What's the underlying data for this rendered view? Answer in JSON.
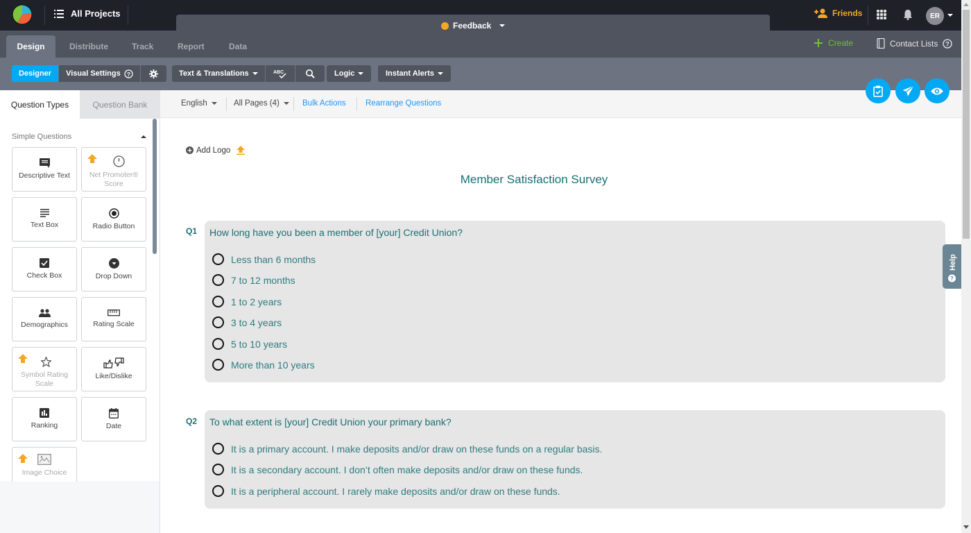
{
  "topbar": {
    "projects_label": "All Projects",
    "survey_name": "Feedback",
    "survey_status_color": "#f5a623",
    "friends_label": "Friends",
    "avatar_initials": "ER"
  },
  "nav": {
    "tabs": [
      {
        "label": "Design",
        "active": true
      },
      {
        "label": "Distribute"
      },
      {
        "label": "Track"
      },
      {
        "label": "Report"
      },
      {
        "label": "Data"
      }
    ],
    "create_label": "Create",
    "contact_lists_label": "Contact Lists"
  },
  "toolbar": {
    "designer_label": "Designer",
    "visual_settings_label": "Visual Settings",
    "text_translations_label": "Text & Translations",
    "spellcheck_label": "ABC",
    "logic_label": "Logic",
    "instant_alerts_label": "Instant Alerts"
  },
  "left_panel": {
    "tabs": [
      "Question Types",
      "Question Bank"
    ],
    "section_title": "Simple Questions",
    "question_types": [
      {
        "label": "Descriptive Text",
        "icon": "comment-icon",
        "upgrade": false
      },
      {
        "label": "Net Promoter® Score",
        "icon": "gauge-icon",
        "upgrade": true
      },
      {
        "label": "Text Box",
        "icon": "lines-icon",
        "upgrade": false
      },
      {
        "label": "Radio Button",
        "icon": "radio-icon",
        "upgrade": false
      },
      {
        "label": "Check Box",
        "icon": "checkbox-icon",
        "upgrade": false
      },
      {
        "label": "Drop Down",
        "icon": "dropdown-icon",
        "upgrade": false
      },
      {
        "label": "Demographics",
        "icon": "people-icon",
        "upgrade": false
      },
      {
        "label": "Rating Scale",
        "icon": "ruler-icon",
        "upgrade": false
      },
      {
        "label": "Symbol Rating Scale",
        "icon": "star-icon",
        "upgrade": true
      },
      {
        "label": "Like/Dislike",
        "icon": "thumbs-icon",
        "upgrade": false
      },
      {
        "label": "Ranking",
        "icon": "bar-chart-icon",
        "upgrade": false
      },
      {
        "label": "Date",
        "icon": "calendar-icon",
        "upgrade": false
      },
      {
        "label": "Image Choice",
        "icon": "image-icon",
        "upgrade": true
      }
    ]
  },
  "subbar": {
    "language": "English",
    "pages": "All Pages (4)",
    "bulk_actions": "Bulk Actions",
    "rearrange": "Rearrange Questions"
  },
  "survey": {
    "add_logo": "Add Logo",
    "title": "Member Satisfaction Survey",
    "questions": [
      {
        "number": "Q1",
        "text": "How long have you been a member of [your] Credit Union?",
        "options": [
          "Less than 6 months",
          "7 to 12 months",
          "1 to 2 years",
          "3 to 4 years",
          "5 to 10 years",
          "More than 10 years"
        ]
      },
      {
        "number": "Q2",
        "text": "To what extent is [your] Credit Union your primary bank?",
        "options": [
          "It is a primary account. I make deposits and/or draw on these funds on a regular basis.",
          "It is a secondary account. I don’t often make deposits and/or draw on these funds.",
          "It is a peripheral account. I rarely make deposits and/or draw on these funds."
        ]
      }
    ]
  },
  "help_label": "Help",
  "colors": {
    "accent": "#03a9f4",
    "teal_text": "#1a6e73",
    "create_green": "#6fbf3a",
    "upgrade_orange": "#f5a623"
  }
}
